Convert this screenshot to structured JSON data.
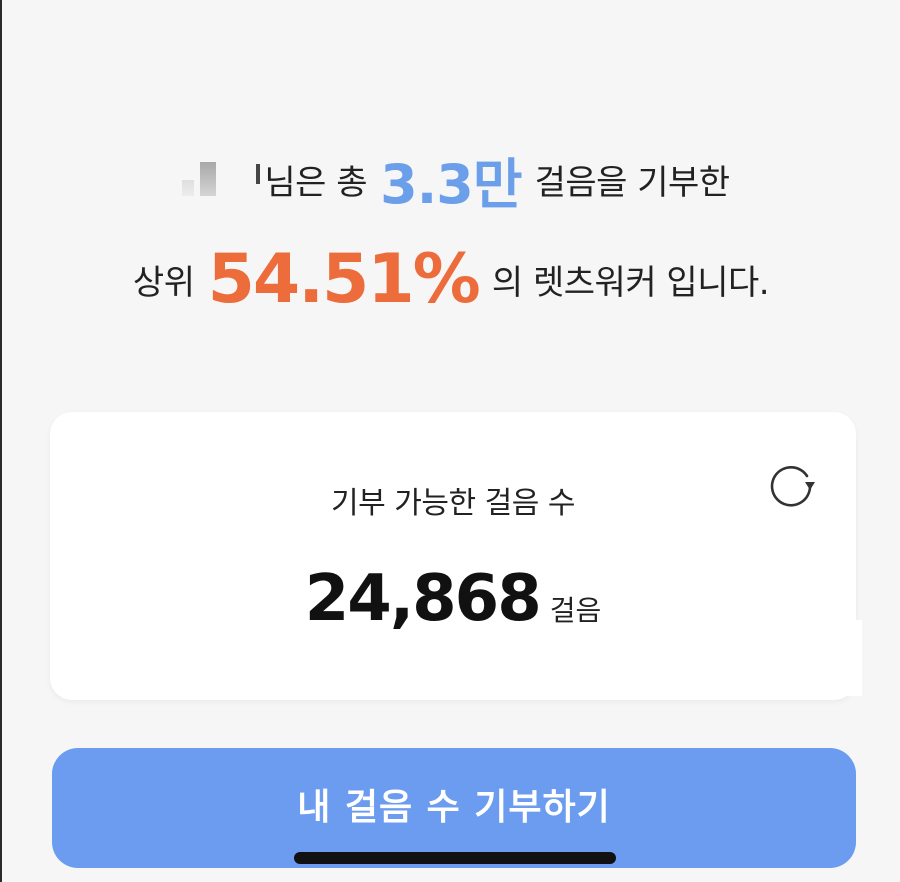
{
  "summary": {
    "line1_suffix": "님은 총",
    "total_steps": "3.3만",
    "line1_end": "걸음을 기부한",
    "rank_prefix": "상위",
    "rank_percent": "54.51%",
    "rank_suffix": "의 렛츠워커 입니다."
  },
  "card": {
    "title": "기부 가능한 걸음 수",
    "steps_value": "24,868",
    "steps_unit": "걸음",
    "refresh_icon": "refresh-icon"
  },
  "donate_button": {
    "label": "내 걸음 수 기부하기"
  },
  "colors": {
    "accent_blue": "#6b9fea",
    "accent_orange": "#ec6c3b",
    "button_blue": "#6b9cef",
    "background": "#f6f6f7"
  }
}
